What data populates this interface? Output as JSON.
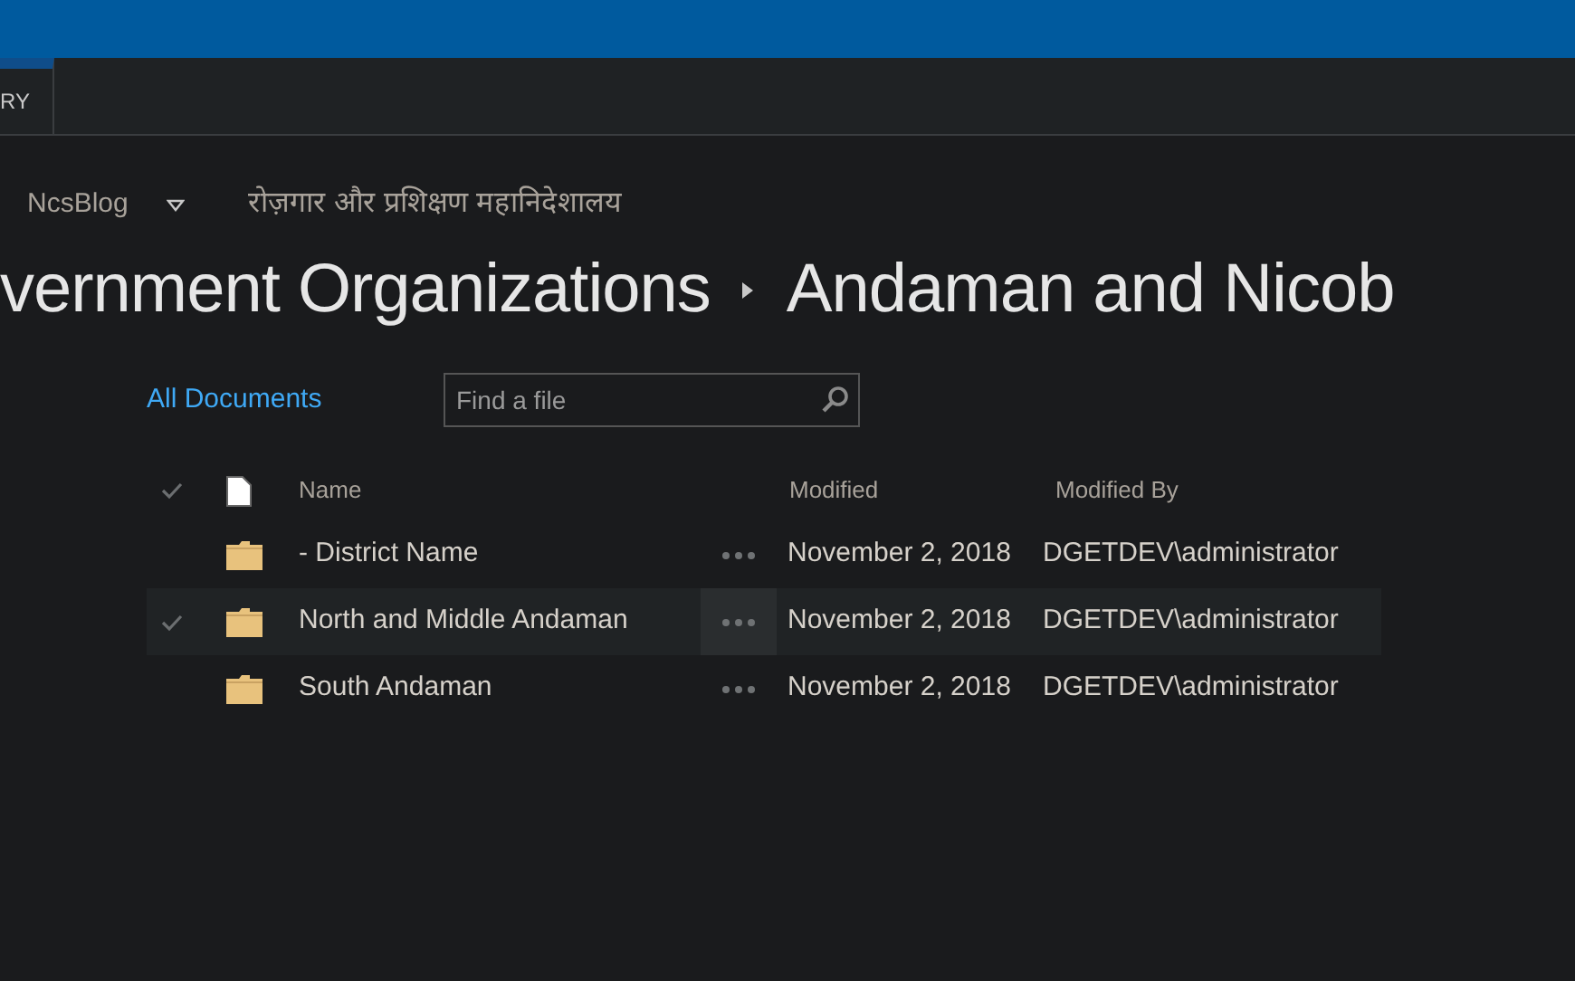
{
  "ribbon": {
    "tabs": [
      {
        "label": "RY",
        "selected": true
      }
    ]
  },
  "site_nav": {
    "site": "NcsBlog",
    "link": "रोज़गार और प्रशिक्षण महानिदेशालय"
  },
  "breadcrumb": [
    "vernment Organizations",
    "Andaman and Nicob"
  ],
  "view": {
    "label": "All Documents"
  },
  "search": {
    "placeholder": "Find a file"
  },
  "table": {
    "columns": [
      "Name",
      "Modified",
      "Modified By"
    ],
    "rows": [
      {
        "name": "- District Name",
        "modified": "November 2, 2018",
        "modified_by": "DGETDEV\\administrator",
        "selected": false
      },
      {
        "name": "North and Middle Andaman",
        "modified": "November 2, 2018",
        "modified_by": "DGETDEV\\administrator",
        "selected": true
      },
      {
        "name": "South Andaman",
        "modified": "November 2, 2018",
        "modified_by": "DGETDEV\\administrator",
        "selected": false
      }
    ]
  }
}
